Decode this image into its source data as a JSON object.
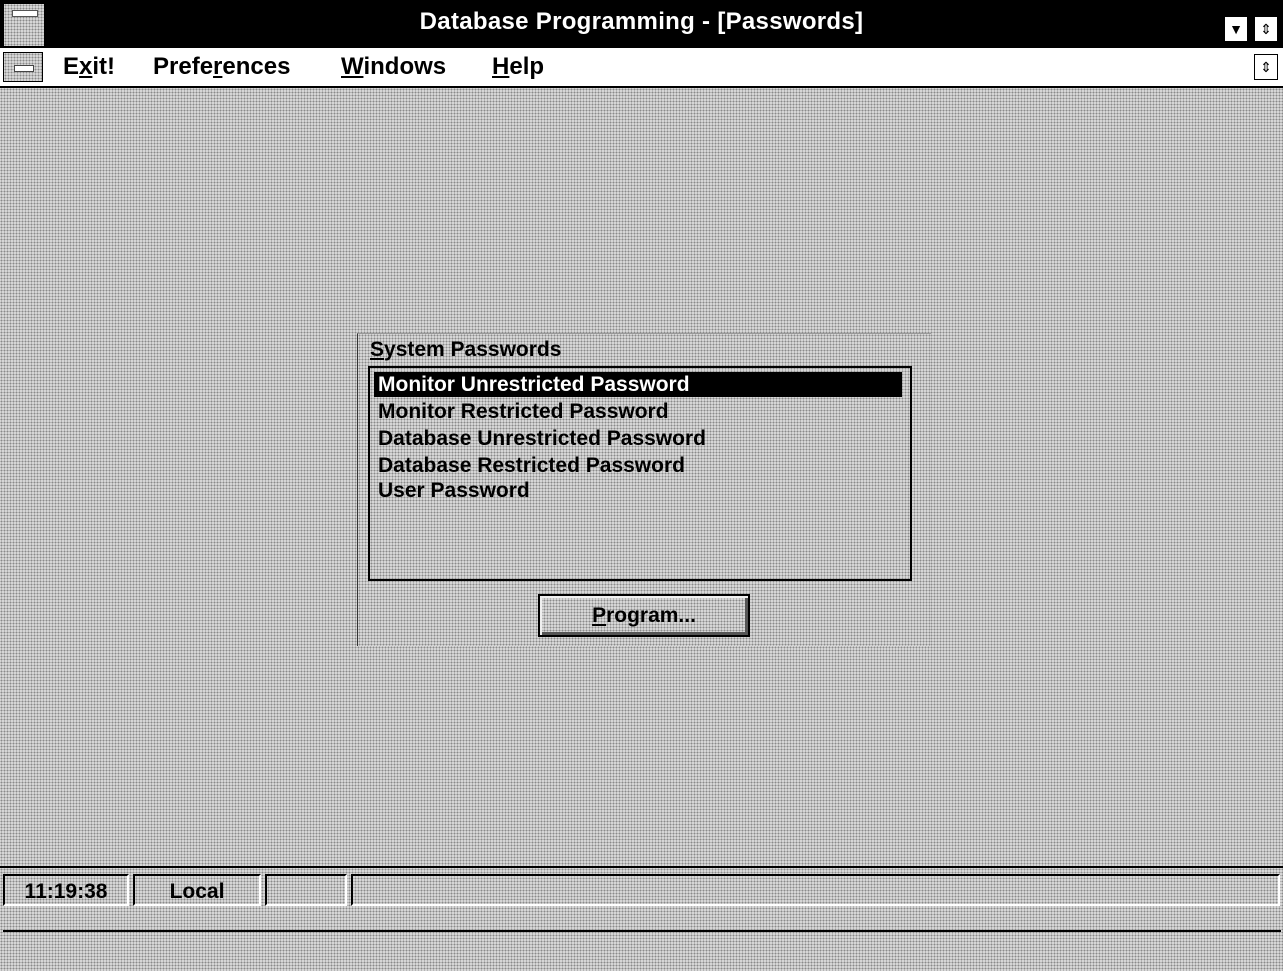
{
  "window": {
    "title": "Database Programming - [Passwords]"
  },
  "menu": {
    "exit": {
      "pre": "E",
      "u": "x",
      "post": "it!"
    },
    "preferences": {
      "pre": "Prefe",
      "u": "r",
      "post": "ences"
    },
    "windows": {
      "pre": "",
      "u": "W",
      "post": "indows"
    },
    "help": {
      "pre": "",
      "u": "H",
      "post": "elp"
    }
  },
  "dialog": {
    "label_u": "S",
    "label_rest": "ystem Passwords",
    "items": [
      "Monitor Unrestricted Password",
      "Monitor Restricted Password",
      "Database Unrestricted Password",
      "Database Restricted Password",
      "User Password"
    ],
    "selected_index": 0,
    "program_button": {
      "u": "P",
      "rest": "rogram..."
    }
  },
  "status": {
    "time": "11:19:38",
    "mode": "Local"
  },
  "icons": {
    "scroll_arrows": "up-down-arrows-icon",
    "minimize": "down-arrow-icon"
  }
}
